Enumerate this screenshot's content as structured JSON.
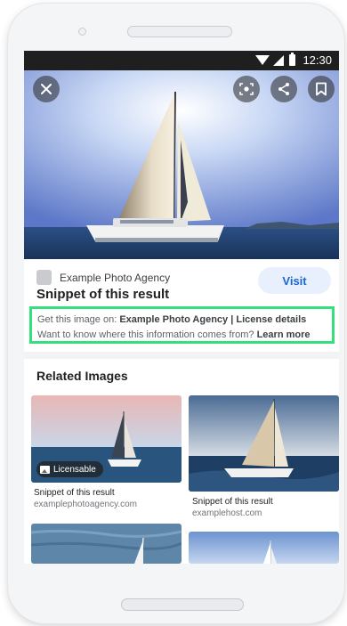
{
  "status_bar": {
    "time": "12:30"
  },
  "hero": {
    "icons": [
      "close-icon",
      "lens-icon",
      "share-icon",
      "bookmark-icon"
    ]
  },
  "result": {
    "source_name": "Example Photo Agency",
    "title": "Snippet of this result",
    "visit_label": "Visit"
  },
  "license": {
    "line1_prefix": "Get this image on: ",
    "line1_agency": "Example Photo Agency",
    "line1_sep": " | ",
    "line1_link": "License details",
    "line2_prefix": "Want to know where this information comes from? ",
    "line2_link": "Learn more"
  },
  "related": {
    "heading": "Related Images",
    "items": [
      {
        "badge": "Licensable",
        "title": "Snippet of this result",
        "site": "examplephotoagency.com"
      },
      {
        "title": "Snippet of this result",
        "site": "examplehost.com"
      }
    ]
  },
  "colors": {
    "accent": "#1967d2",
    "highlight": "#34e07a",
    "visit_bg": "#e8f0fe"
  }
}
